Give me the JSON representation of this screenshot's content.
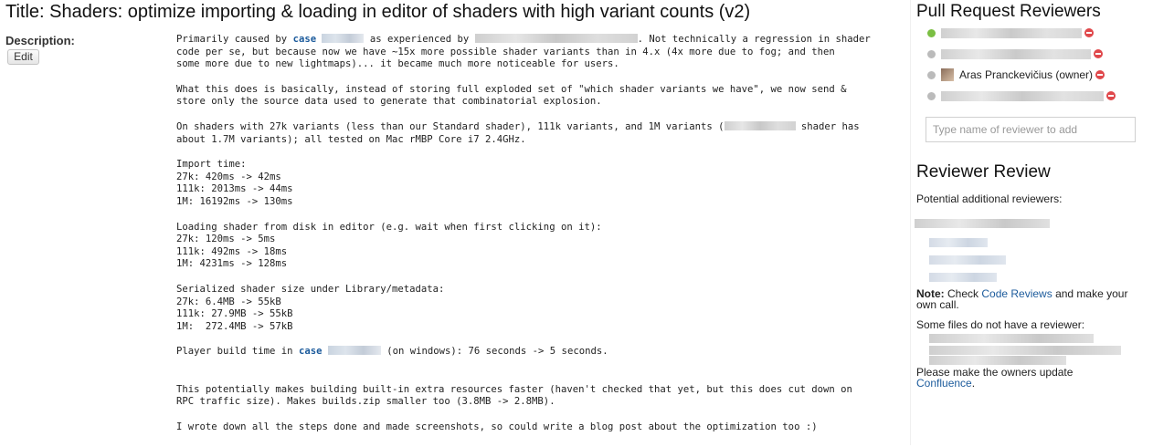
{
  "header": {
    "title": "Title: Shaders: optimize importing & loading in editor of shaders with high variant counts (v2)"
  },
  "description": {
    "label": "Description:",
    "edit_label": "Edit",
    "p1": {
      "a": "Primarily caused by ",
      "link": "case",
      "b": " as experienced by ",
      "c": ". Not technically a regression in shader\ncode per se, but because now we have ~15x more possible shader variants than in 4.x (4x more due to fog; and then\nsome more due to new lightmaps)... it became much more noticeable for users."
    },
    "p2": "What this does is basically, instead of storing full exploded set of \"which shader variants we have\", we now send &\nstore only the source data used to generate that combinatorial explosion.",
    "p3": {
      "a": "On shaders with 27k variants (less than our Standard shader), 111k variants, and 1M variants (",
      "b": " shader has\nabout 1.7M variants); all tested on Mac rMBP Core i7 2.4GHz."
    },
    "p4": "Import time:\n27k: 420ms -> 42ms\n111k: 2013ms -> 44ms\n1M: 16192ms -> 130ms",
    "p5": "Loading shader from disk in editor (e.g. wait when first clicking on it):\n27k: 120ms -> 5ms\n111k: 492ms -> 18ms\n1M: 4231ms -> 128ms",
    "p6": "Serialized shader size under Library/metadata:\n27k: 6.4MB -> 55kB\n111k: 27.9MB -> 55kB\n1M:  272.4MB -> 57kB",
    "p7": {
      "a": "Player build time in ",
      "link": "case",
      "b": " (on windows): 76 seconds -> 5 seconds."
    },
    "p8": "This potentially makes building built-in extra resources faster (haven't checked that yet, but this does cut down on\nRPC traffic size). Makes builds.zip smaller too (3.8MB -> 2.8MB).",
    "p9": "I wrote down all the steps done and made screenshots, so could write a blog post about the optimization too :)"
  },
  "sidebar": {
    "reviewers_title": "Pull Request Reviewers",
    "owner_name": "Aras Pranckevičius (owner)",
    "add_placeholder": "Type name of reviewer to add",
    "review_title": "Reviewer Review",
    "potential": "Potential additional reviewers:",
    "note_label": "Note:",
    "note_a": " Check ",
    "note_link": "Code Reviews",
    "note_b": " and make your",
    "note_c": "own call.",
    "files_text": "Some files do not have a reviewer:",
    "owners_text": "Please make the owners update",
    "owners_link": "Confluence",
    "owners_end": ".",
    "colors": {
      "link": "#1c5b9c",
      "remove": "#e0484b",
      "online": "#7bbf43"
    }
  }
}
